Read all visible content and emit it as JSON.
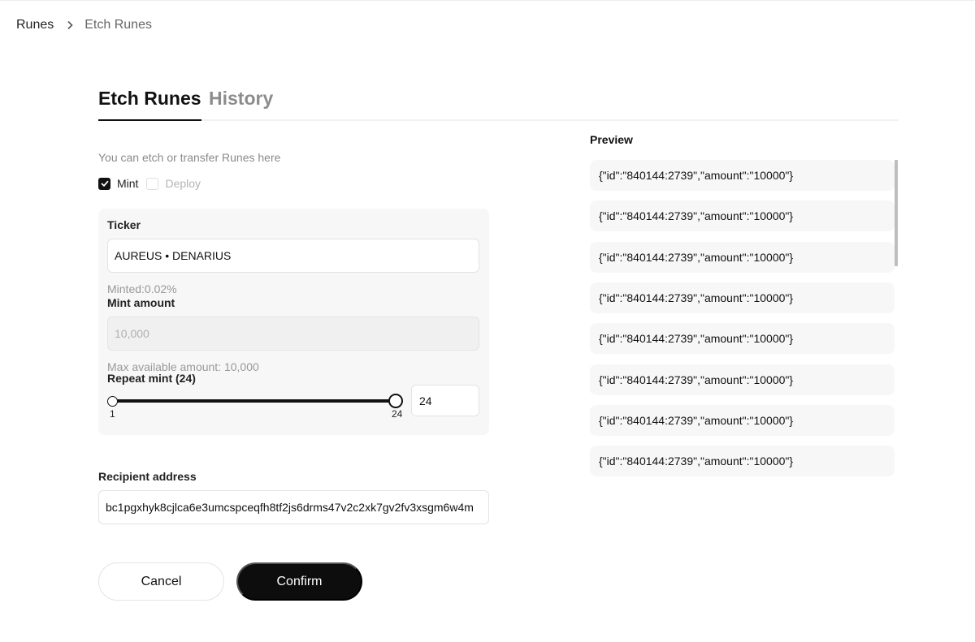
{
  "breadcrumb": {
    "root": "Runes",
    "separator_icon": "chevron-right-icon",
    "current": "Etch Runes"
  },
  "tabs": [
    {
      "label": "Etch Runes",
      "active": true
    },
    {
      "label": "History",
      "active": false
    }
  ],
  "form": {
    "subtitle": "You can etch or transfer Runes here",
    "options": [
      {
        "label": "Mint",
        "checked": true,
        "disabled": false
      },
      {
        "label": "Deploy",
        "checked": false,
        "disabled": true
      }
    ],
    "ticker": {
      "label": "Ticker",
      "value": "AUREUS • DENARIUS"
    },
    "minted": "Minted:0.02%",
    "mint_amount": {
      "label": "Mint amount",
      "value": "10,000",
      "disabled": true
    },
    "max_available": "Max available amount: 10,000",
    "repeat_mint": {
      "label": "Repeat mint (24)",
      "min": 1,
      "max": 24,
      "value": 24,
      "min_label": "1",
      "max_label": "24",
      "input_value": "24"
    },
    "recipient": {
      "label": "Recipient address",
      "value": "bc1pgxhyk8cjlca6e3umcspceqfh8tf2js6drms47v2c2xk7gv2fv3xsgm6w4m"
    }
  },
  "actions": {
    "cancel_label": "Cancel",
    "confirm_label": "Confirm"
  },
  "preview": {
    "title": "Preview",
    "items": [
      "{\"id\":\"840144:2739\",\"amount\":\"10000\"}",
      "{\"id\":\"840144:2739\",\"amount\":\"10000\"}",
      "{\"id\":\"840144:2739\",\"amount\":\"10000\"}",
      "{\"id\":\"840144:2739\",\"amount\":\"10000\"}",
      "{\"id\":\"840144:2739\",\"amount\":\"10000\"}",
      "{\"id\":\"840144:2739\",\"amount\":\"10000\"}",
      "{\"id\":\"840144:2739\",\"amount\":\"10000\"}",
      "{\"id\":\"840144:2739\",\"amount\":\"10000\"}"
    ]
  }
}
